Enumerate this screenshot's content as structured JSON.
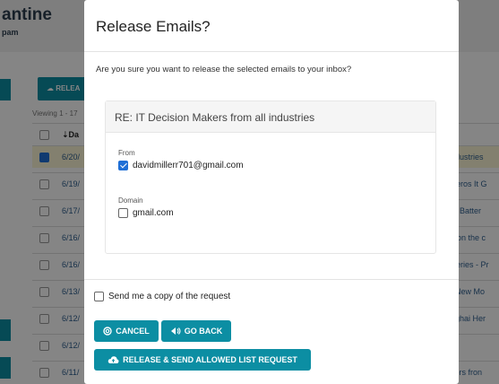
{
  "background": {
    "app_title": "antine",
    "app_subtitle": "pam",
    "release_button_label": "RELEA",
    "viewing_text": "Viewing 1 - 17",
    "table_header": {
      "date": "Da"
    },
    "rows": [
      {
        "date": "6/20/",
        "subject": "ndustries",
        "selected": true
      },
      {
        "date": "6/19/",
        "subject": "Aeros It G",
        "selected": false
      },
      {
        "date": "6/17/",
        "subject": "m Batter",
        "selected": false
      },
      {
        "date": "6/16/",
        "subject": "k on the c",
        "selected": false
      },
      {
        "date": "6/16/",
        "subject": "Series - Pr",
        "selected": false
      },
      {
        "date": "6/13/",
        "subject": "l-New Mo",
        "selected": false
      },
      {
        "date": "6/12/",
        "subject": "nghai Her",
        "selected": false
      },
      {
        "date": "6/12/",
        "subject": "",
        "selected": false
      },
      {
        "date": "6/11/",
        "subject": "itors fron",
        "selected": false
      }
    ]
  },
  "modal": {
    "title": "Release Emails?",
    "question": "Are you sure you want to release the selected emails to your inbox?",
    "email_subject": "RE: IT Decision Makers from all industries",
    "from_label": "From",
    "from_value": "davidmillerr701@gmail.com",
    "from_checked": true,
    "domain_label": "Domain",
    "domain_value": "gmail.com",
    "domain_checked": false,
    "copy_label": "Send me a copy of the request",
    "copy_checked": false,
    "cancel_label": "CANCEL",
    "go_back_label": "GO BACK",
    "release_label": "RELEASE & SEND ALLOWED LIST REQUEST"
  },
  "colors": {
    "accent": "#0c8ea3",
    "checkbox": "#1f6fd6",
    "selected_row": "#fbf5d5"
  },
  "icons": {
    "cancel": "cancel-circle-icon",
    "go_back": "back-arrow-icon",
    "release": "cloud-upload-icon"
  }
}
